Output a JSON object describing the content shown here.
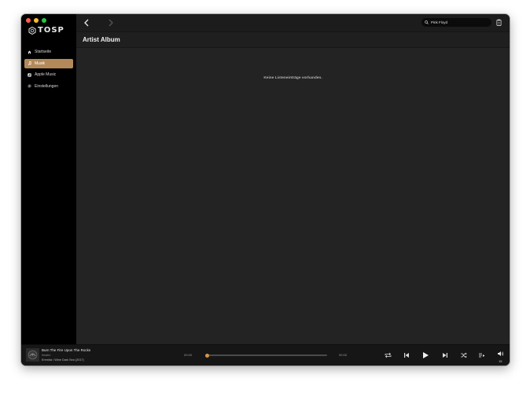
{
  "app": {
    "logo_text": "TOSP"
  },
  "sidebar": {
    "items": [
      {
        "label": "Startseite",
        "icon": "home-icon",
        "active": false
      },
      {
        "label": "Musik",
        "icon": "music-note-icon",
        "active": true
      },
      {
        "label": "Apple Music",
        "icon": "apple-music-icon",
        "active": false
      },
      {
        "label": "Einstellungen",
        "icon": "gear-icon",
        "active": false
      }
    ]
  },
  "search": {
    "value": "Pink Floyd",
    "placeholder": ""
  },
  "page": {
    "title": "Artist Album",
    "empty_message": "Keine Listeneinträge vorhanden."
  },
  "player": {
    "track_title": "Burn The Fire Upon The Rocks",
    "artist": "Ihsahn",
    "album": "Eremita / Wine Dark Sea (2017)",
    "time_current": "00:00",
    "time_total": "00:00",
    "progress": 0.0,
    "volume": "15"
  },
  "colors": {
    "accent": "#b4895a",
    "progress": "#c48a4e",
    "background": "#232323",
    "sidebar": "#000000"
  }
}
